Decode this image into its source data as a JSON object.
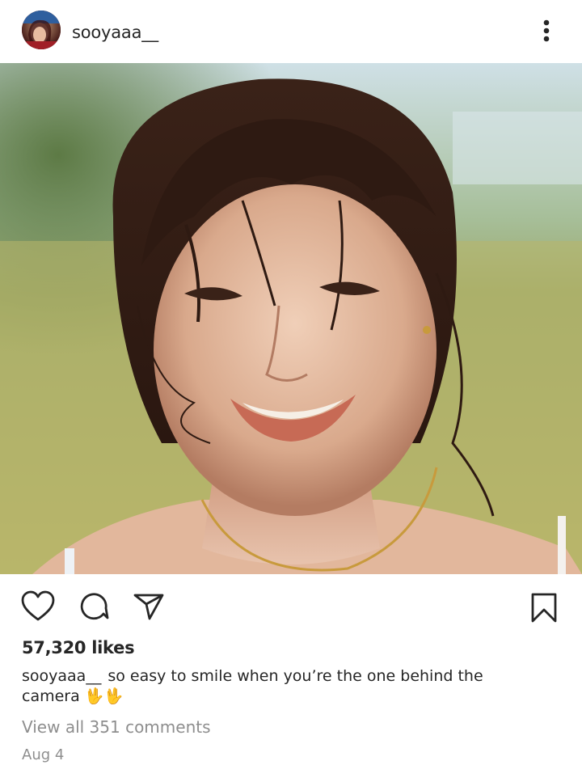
{
  "post": {
    "username": "sooyaaa__",
    "likes": "57,320 likes",
    "caption_user": "sooyaaa__",
    "caption_text": "so easy to smile when you’re the one behind the camera 🖖🖖",
    "view_comments": "View all 351 comments",
    "date": "Aug 4"
  },
  "icons": {
    "more": "more-options-icon",
    "like": "heart-icon",
    "comment": "comment-icon",
    "share": "share-icon",
    "save": "bookmark-icon"
  },
  "colors": {
    "text": "#262626",
    "muted": "#8e8e8e",
    "background": "#ffffff"
  }
}
